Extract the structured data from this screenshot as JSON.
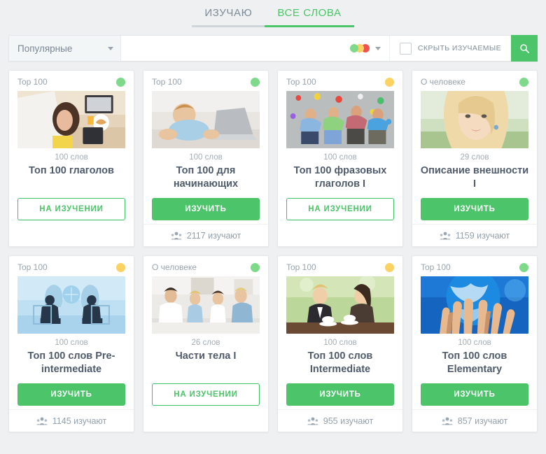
{
  "tabs": [
    {
      "label": "ИЗУЧАЮ",
      "active": false,
      "name": "tab-studying"
    },
    {
      "label": "ВСЕ СЛОВА",
      "active": true,
      "name": "tab-all-words"
    }
  ],
  "toolbar": {
    "sort_selected": "Популярные",
    "search_value": "",
    "search_placeholder": "",
    "status_dots": [
      "#7ed98a",
      "#fcd265",
      "#ef5350"
    ],
    "hide_studied_label": "СКРЫТЬ ИЗУЧАЕМЫЕ",
    "hide_studied_checked": false,
    "search_icon": "search-icon",
    "caret_icon": "chevron-down-icon"
  },
  "colors": {
    "accent_green": "#4cc46a",
    "dot_green": "#7ed98a",
    "dot_yellow": "#fcd265",
    "dot_red": "#ef5350",
    "page_bg": "#eef0f1",
    "title_text": "#4f5b6b",
    "muted_text": "#98a3ad"
  },
  "cards": [
    {
      "category": "Top 100",
      "status": "green",
      "words": "100 слов",
      "title": "Топ 100 глаголов",
      "button": "НА ИЗУЧЕНИИ",
      "button_style": "outline",
      "learners": "",
      "image": "woman-laptop-croissant"
    },
    {
      "category": "Top 100",
      "status": "green",
      "words": "100 слов",
      "title": "Топ 100 для начинающих",
      "button": "ИЗУЧИТЬ",
      "button_style": "filled",
      "learners": "2117 изучают",
      "image": "baby-with-laptop"
    },
    {
      "category": "Top 100",
      "status": "yellow",
      "words": "100 слов",
      "title": "Топ 100 фразовых глаголов I",
      "button": "НА ИЗУЧЕНИИ",
      "button_style": "outline",
      "learners": "",
      "image": "people-on-floor-confetti"
    },
    {
      "category": "О человеке",
      "status": "green",
      "words": "29 слов",
      "title": "Описание внешности I",
      "button": "ИЗУЧИТЬ",
      "button_style": "filled",
      "learners": "1159 изучают",
      "image": "blonde-woman-portrait"
    },
    {
      "category": "Top 100",
      "status": "yellow",
      "words": "100 слов",
      "title": "Топ 100 слов Pre-intermediate",
      "button": "ИЗУЧИТЬ",
      "button_style": "filled",
      "learners": "1145 изучают",
      "image": "business-meeting-silhouette"
    },
    {
      "category": "О человеке",
      "status": "green",
      "words": "26 слов",
      "title": "Части тела I",
      "button": "НА ИЗУЧЕНИИ",
      "button_style": "outline",
      "learners": "",
      "image": "family-on-bed"
    },
    {
      "category": "Top 100",
      "status": "yellow",
      "words": "100 слов",
      "title": "Топ 100 слов Intermediate",
      "button": "ИЗУЧИТЬ",
      "button_style": "filled",
      "learners": "955 изучают",
      "image": "two-women-coffee"
    },
    {
      "category": "Top 100",
      "status": "green",
      "words": "100 слов",
      "title": "Топ 100 слов Elementary",
      "button": "ИЗУЧИТЬ",
      "button_style": "filled",
      "learners": "857 изучают",
      "image": "hands-reaching-globe"
    }
  ]
}
